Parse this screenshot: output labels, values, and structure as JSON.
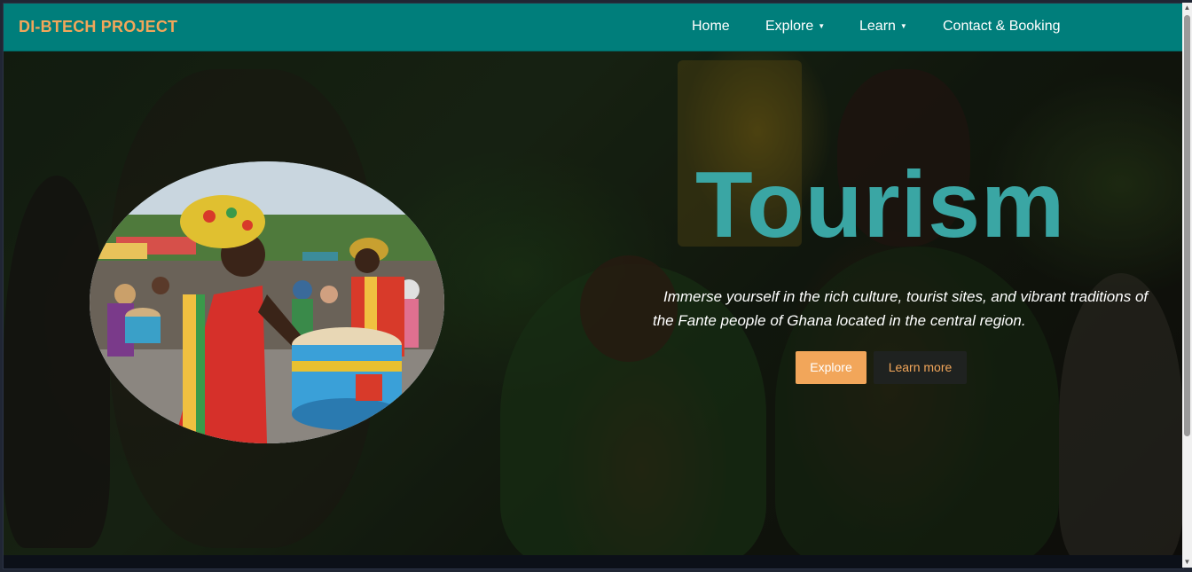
{
  "brand": {
    "name": "DI-BTECH PROJECT"
  },
  "nav": {
    "home": "Home",
    "explore": "Explore",
    "learn": "Learn",
    "contact": "Contact & Booking",
    "caret": "▼"
  },
  "hero": {
    "title": "Tourism",
    "description": "Immerse yourself in the rich culture, tourist sites, and vibrant traditions of the Fante people of Ghana located in the central region.",
    "explore_button": "Explore",
    "learn_button": "Learn more",
    "photo_icon": "drummer-photo"
  },
  "scrollbar": {
    "up": "▲",
    "down": "▼"
  },
  "colors": {
    "navbar": "#007e7b",
    "brand": "#f2a65a",
    "title": "#3aa6a4",
    "explore_button": "#f2a65a",
    "learn_button": "#1f2220"
  }
}
